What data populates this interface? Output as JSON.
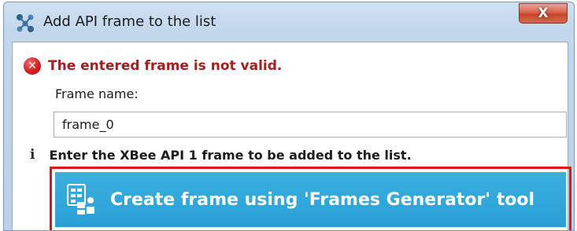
{
  "window": {
    "title": "Add API frame to the list",
    "close_label": "X"
  },
  "error": {
    "icon": "error-icon",
    "icon_glyph": "✕",
    "message": "The entered frame is not valid."
  },
  "frame_name": {
    "label": "Frame name:",
    "value": "frame_0"
  },
  "info": {
    "icon": "info-icon",
    "icon_glyph": "i",
    "message": "Enter the XBee API 1 frame to be added to the list."
  },
  "generator_button": {
    "icon": "frames-generator-icon",
    "label": "Create frame using 'Frames Generator' tool",
    "highlight_color": "#e0141b",
    "background_color": "#2a9fd6"
  }
}
